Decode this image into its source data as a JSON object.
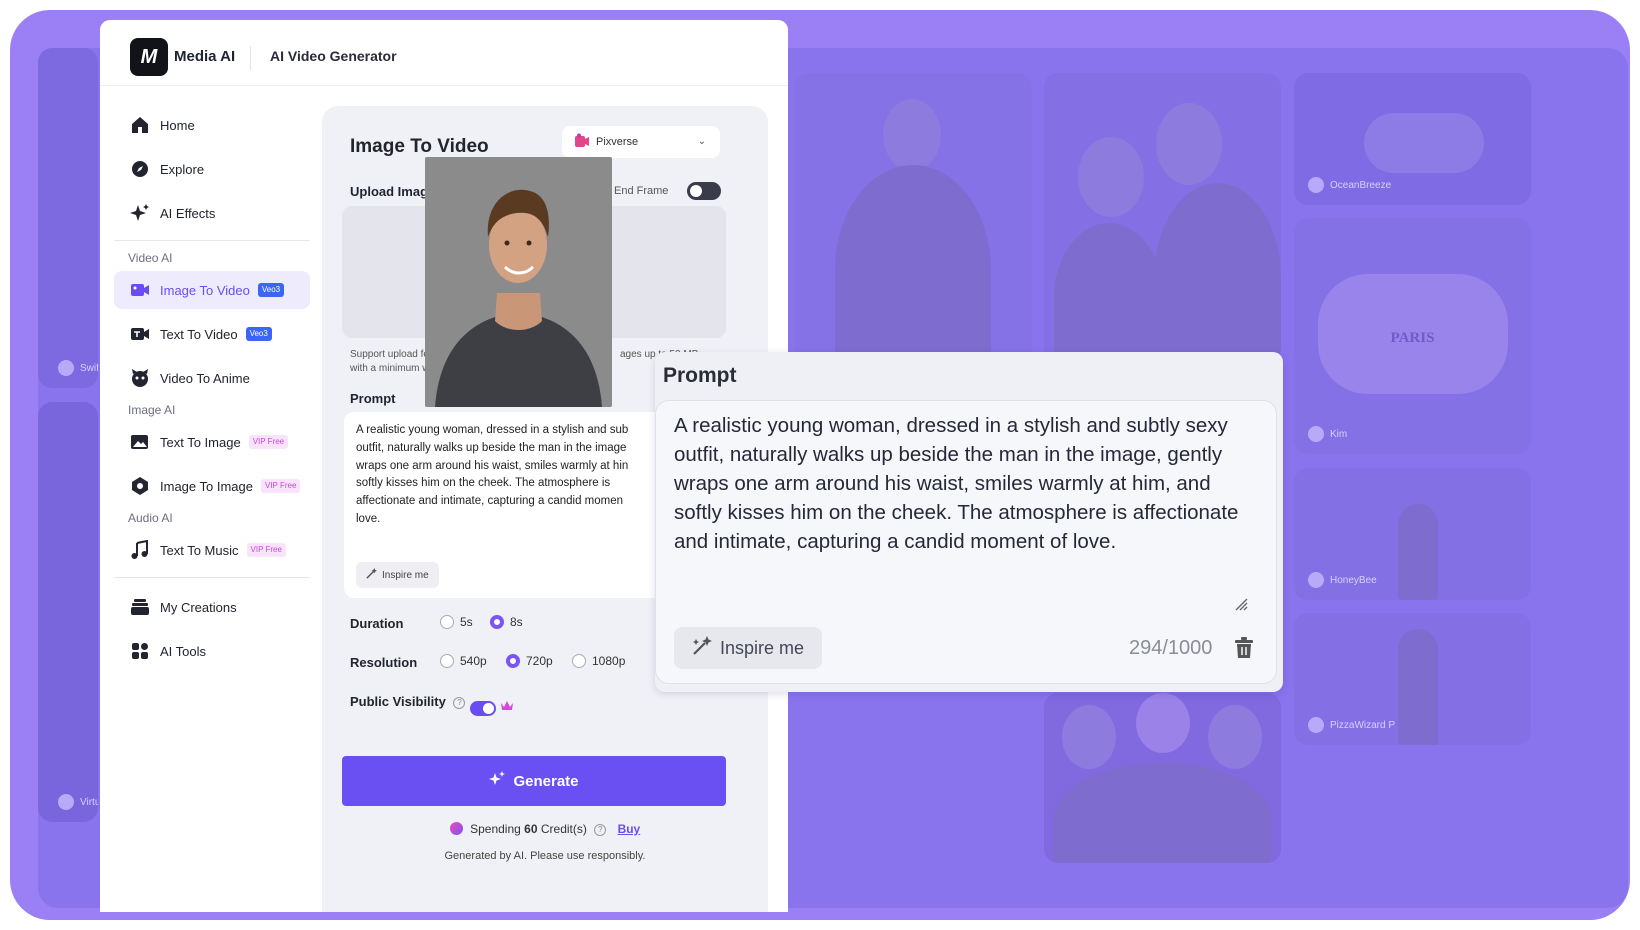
{
  "header": {
    "logo_mark": "M",
    "brand": "Media AI",
    "title": "AI Video Generator"
  },
  "sidebar": {
    "top_items": [
      {
        "label": "Home",
        "icon": "home-icon"
      },
      {
        "label": "Explore",
        "icon": "compass-icon"
      },
      {
        "label": "AI Effects",
        "icon": "sparkle-icon"
      }
    ],
    "video_section": "Video AI",
    "video_items": [
      {
        "label": "Image To Video",
        "badge": "Veo3",
        "icon": "image-video-icon",
        "active": true
      },
      {
        "label": "Text To Video",
        "badge": "Veo3",
        "icon": "text-video-icon"
      },
      {
        "label": "Video To Anime",
        "icon": "anime-icon"
      }
    ],
    "image_section": "Image AI",
    "image_items": [
      {
        "label": "Text To Image",
        "badge": "VIP Free",
        "icon": "text-image-icon"
      },
      {
        "label": "Image To Image",
        "badge": "VIP Free",
        "icon": "image-image-icon"
      }
    ],
    "audio_section": "Audio AI",
    "audio_items": [
      {
        "label": "Text To Music",
        "badge": "VIP Free",
        "icon": "music-icon"
      }
    ],
    "bottom_items": [
      {
        "label": "My Creations",
        "icon": "creations-icon"
      },
      {
        "label": "AI Tools",
        "icon": "tools-icon"
      }
    ]
  },
  "main": {
    "section_title": "Image To Video",
    "model": "Pixverse",
    "upload_label": "Upload Images",
    "end_frame_label": "End Frame",
    "support_text_1": "Support upload fo",
    "support_text_1b": "ages up to 50 MB",
    "support_text_2": "with a minimum w",
    "prompt_label": "Prompt",
    "prompt_lines": [
      "A realistic young woman, dressed in a stylish and sub",
      "outfit, naturally walks up beside the man in the image",
      "wraps one arm around his waist, smiles warmly at hin",
      "softly kisses him on the cheek. The atmosphere is",
      "affectionate and intimate, capturing a candid momen",
      "love."
    ],
    "inspire_label": "Inspire me",
    "count_partial": "294",
    "duration_label": "Duration",
    "duration_options": [
      "5s",
      "8s"
    ],
    "duration_selected": "8s",
    "resolution_label": "Resolution",
    "resolution_options": [
      "540p",
      "720p",
      "1080p"
    ],
    "resolution_selected": "720p",
    "visibility_label": "Public Visibility",
    "generate_label": "Generate",
    "spending_prefix": "Spending",
    "spending_amount": "60",
    "spending_suffix": "Credit(s)",
    "buy_label": "Buy",
    "disclaimer": "Generated by AI. Please use responsibly."
  },
  "zoom": {
    "title": "Prompt",
    "text": "A realistic young woman, dressed in a stylish and subtly sexy outfit, naturally walks up beside the man in the image, gently wraps one arm around his waist, smiles warmly at him, and softly kisses him on the cheek. The atmosphere is affectionate and intimate, capturing a candid moment of love.",
    "inspire_label": "Inspire me",
    "count": "294/1000"
  },
  "gallery": {
    "users": [
      "Swift",
      "Virtu",
      "OceanBreeze",
      "Kim",
      "HoneyBee",
      "PizzaWizard P"
    ],
    "sign_text": "PARIS"
  },
  "colors": {
    "accent": "#6a4df2",
    "background_purple": "#9a7ff5",
    "veo_badge": "#3b66f5",
    "vip_badge_text": "#c34ad6"
  }
}
